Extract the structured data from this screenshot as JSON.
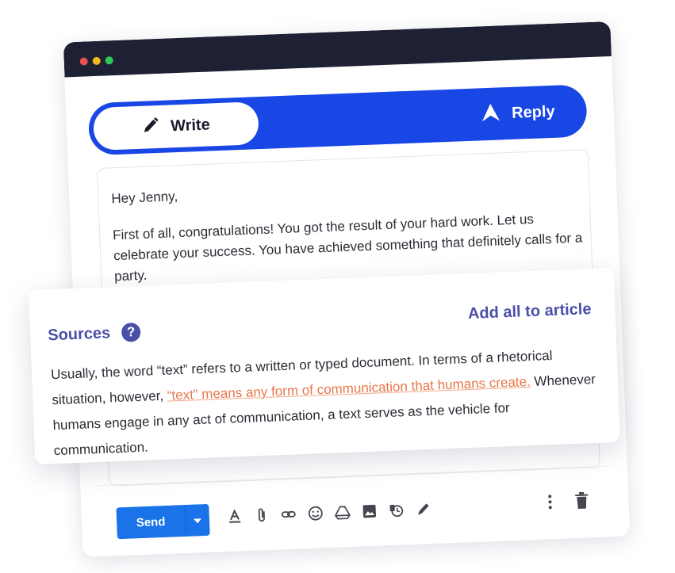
{
  "window": {
    "controls": [
      "close",
      "minimize",
      "maximize"
    ],
    "colors": {
      "titlebar": "#1e2033",
      "close": "#ec5050",
      "minimize": "#f2b91e",
      "maximize": "#2fc95a"
    }
  },
  "mode_toggle": {
    "write_label": "Write",
    "reply_label": "Reply",
    "active": "Write",
    "accent": "#1947e6"
  },
  "email": {
    "greeting": "Hey Jenny,",
    "body": "First of all, congratulations! You got the result of your hard work. Let us celebrate your success. You have achieved something that definitely calls for a party."
  },
  "sources": {
    "title": "Sources",
    "help_icon_glyph": "?",
    "add_all_label": "Add all to article",
    "text_before": "Usually, the word “text” refers to a written or typed document. In terms of a rhetorical situation, however, ",
    "link_text": "“text” means any form of communication that humans create.",
    "text_after": " Whenever humans engage in any act of communication, a text serves as the vehicle for communication.",
    "colors": {
      "heading": "#4a4fa8",
      "link": "#e8774a"
    }
  },
  "compose_toolbar": {
    "send_label": "Send",
    "icons": [
      "format-text-icon",
      "attach-icon",
      "link-icon",
      "emoji-icon",
      "drive-icon",
      "image-icon",
      "confidential-icon",
      "signature-icon"
    ],
    "right_icons": [
      "more-options-icon",
      "trash-icon"
    ],
    "send_color": "#1a73e8"
  }
}
